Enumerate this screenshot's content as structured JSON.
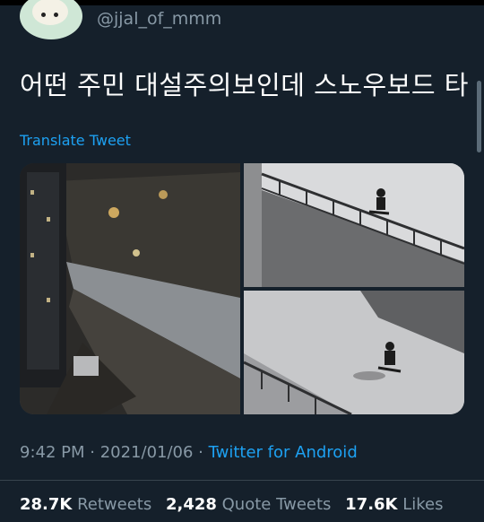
{
  "author": {
    "handle": "@jjal_of_mmm"
  },
  "tweet": {
    "text": "어떤 주민 대설주의보인데 스노우보드 타",
    "translate_label": "Translate Tweet"
  },
  "media": [
    {
      "alt": ""
    },
    {
      "alt": ""
    },
    {
      "alt": ""
    }
  ],
  "meta": {
    "time": "9:42 PM",
    "sep1": " · ",
    "date": "2021/01/06",
    "sep2": " · ",
    "source": "Twitter for Android"
  },
  "stats": {
    "retweets_count": "28.7K",
    "retweets_label": "Retweets",
    "quotes_count": "2,428",
    "quotes_label": "Quote Tweets",
    "likes_count": "17.6K",
    "likes_label": "Likes"
  },
  "colors": {
    "background": "#15202b",
    "link": "#1da1f2",
    "muted": "#8899a6"
  }
}
